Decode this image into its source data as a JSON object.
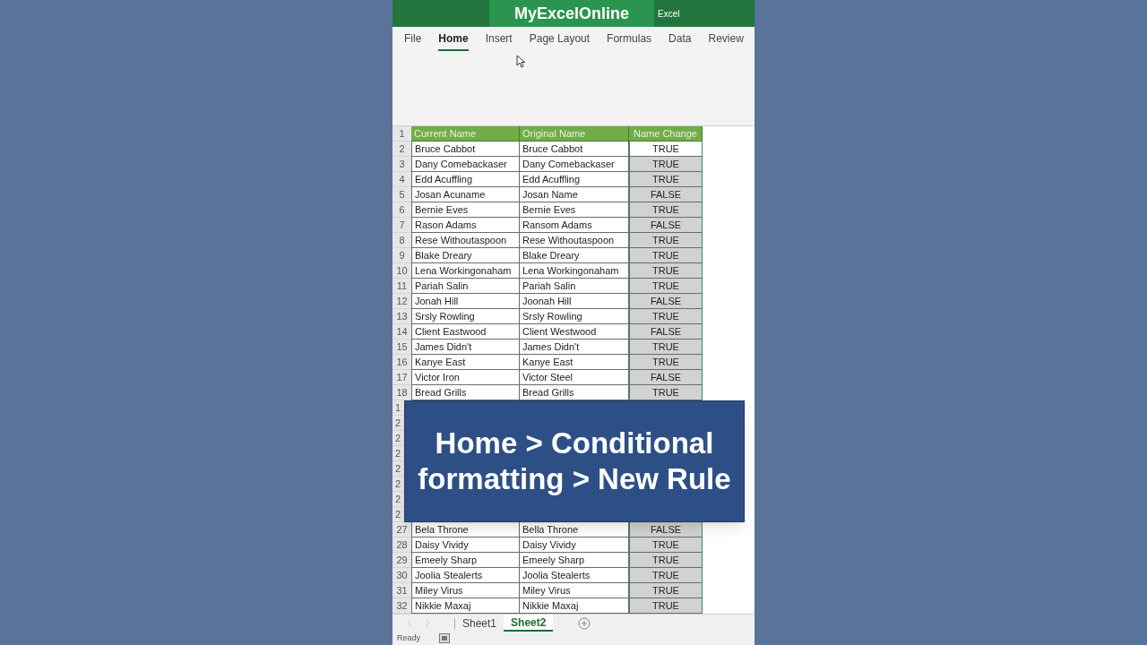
{
  "title_bar": {
    "logo": "MyExcelOnline",
    "app": "Excel"
  },
  "ribbon_tabs": [
    {
      "label": "File",
      "selected": false
    },
    {
      "label": "Home",
      "selected": true
    },
    {
      "label": "Insert",
      "selected": false
    },
    {
      "label": "Page Layout",
      "selected": false
    },
    {
      "label": "Formulas",
      "selected": false
    },
    {
      "label": "Data",
      "selected": false
    },
    {
      "label": "Review",
      "selected": false
    }
  ],
  "sheet": {
    "header_number": "1",
    "columns": [
      "Current Name",
      "Original Name",
      "Name Change"
    ],
    "rows": [
      {
        "kind": "data",
        "number": "2",
        "cells": [
          "Bruce Cabbot",
          "Bruce Cabbot",
          "TRUE"
        ],
        "active": true
      },
      {
        "kind": "data",
        "number": "3",
        "cells": [
          "Dany Comebackaser",
          "Dany Comebackaser",
          "TRUE"
        ],
        "active": false
      },
      {
        "kind": "data",
        "number": "4",
        "cells": [
          "Edd Acuffling",
          "Edd Acuffling",
          "TRUE"
        ],
        "active": false
      },
      {
        "kind": "data",
        "number": "5",
        "cells": [
          "Josan Acuname",
          "Josan Name",
          "FALSE"
        ],
        "active": false
      },
      {
        "kind": "data",
        "number": "6",
        "cells": [
          "Bernie Eves",
          "Bernie Eves",
          "TRUE"
        ],
        "active": false
      },
      {
        "kind": "data",
        "number": "7",
        "cells": [
          "Rason Adams",
          "Ransom Adams",
          "FALSE"
        ],
        "active": false
      },
      {
        "kind": "data",
        "number": "8",
        "cells": [
          "Rese Withoutaspoon",
          "Rese Withoutaspoon",
          "TRUE"
        ],
        "active": false
      },
      {
        "kind": "data",
        "number": "9",
        "cells": [
          "Blake Dreary",
          "Blake Dreary",
          "TRUE"
        ],
        "active": false
      },
      {
        "kind": "data",
        "number": "10",
        "cells": [
          "Lena Workingonaham",
          "Lena Workingonaham",
          "TRUE"
        ],
        "active": false
      },
      {
        "kind": "data",
        "number": "11",
        "cells": [
          "Pariah Salin",
          "Pariah Salin",
          "TRUE"
        ],
        "active": false
      },
      {
        "kind": "data",
        "number": "12",
        "cells": [
          "Jonah Hill",
          "Joonah Hill",
          "FALSE"
        ],
        "active": false
      },
      {
        "kind": "data",
        "number": "13",
        "cells": [
          "Srsly Rowling",
          "Srsly Rowling",
          "TRUE"
        ],
        "active": false
      },
      {
        "kind": "data",
        "number": "14",
        "cells": [
          "Client Eastwood",
          "Client Westwood",
          "FALSE"
        ],
        "active": false
      },
      {
        "kind": "data",
        "number": "15",
        "cells": [
          "James Didn't",
          "James Didn't",
          "TRUE"
        ],
        "active": false
      },
      {
        "kind": "data",
        "number": "16",
        "cells": [
          "Kanye East",
          "Kanye East",
          "TRUE"
        ],
        "active": false
      },
      {
        "kind": "data",
        "number": "17",
        "cells": [
          "Victor Iron",
          "Victor Steel",
          "FALSE"
        ],
        "active": false
      },
      {
        "kind": "data",
        "number": "18",
        "cells": [
          "Bread Grills",
          "Bread Grills",
          "TRUE"
        ],
        "active": false
      },
      {
        "kind": "covered",
        "number": "1"
      },
      {
        "kind": "covered",
        "number": "2"
      },
      {
        "kind": "covered",
        "number": "2"
      },
      {
        "kind": "covered",
        "number": "2"
      },
      {
        "kind": "covered",
        "number": "2"
      },
      {
        "kind": "covered",
        "number": "2"
      },
      {
        "kind": "covered",
        "number": "2"
      },
      {
        "kind": "covered",
        "number": "2"
      },
      {
        "kind": "data",
        "number": "27",
        "cells": [
          "Bela Throne",
          "Bella Throne",
          "FALSE"
        ],
        "active": false
      },
      {
        "kind": "data",
        "number": "28",
        "cells": [
          "Daisy Vividy",
          "Daisy Vividy",
          "TRUE"
        ],
        "active": false
      },
      {
        "kind": "data",
        "number": "29",
        "cells": [
          "Emeely Sharp",
          "Emeely Sharp",
          "TRUE"
        ],
        "active": false
      },
      {
        "kind": "data",
        "number": "30",
        "cells": [
          "Joolia Stealerts",
          "Joolia Stealerts",
          "TRUE"
        ],
        "active": false
      },
      {
        "kind": "data",
        "number": "31",
        "cells": [
          "Miley Virus",
          "Miley Virus",
          "TRUE"
        ],
        "active": false
      },
      {
        "kind": "data",
        "number": "32",
        "cells": [
          "Nikkie Maxaj",
          "Nikkie Maxaj",
          "TRUE"
        ],
        "active": false
      }
    ]
  },
  "overlay_caption": "Home > Conditional formatting > New Rule",
  "sheet_tabs": [
    {
      "label": "Sheet1",
      "selected": false
    },
    {
      "label": "Sheet2",
      "selected": true
    }
  ],
  "status_bar": {
    "text": "Ready"
  }
}
